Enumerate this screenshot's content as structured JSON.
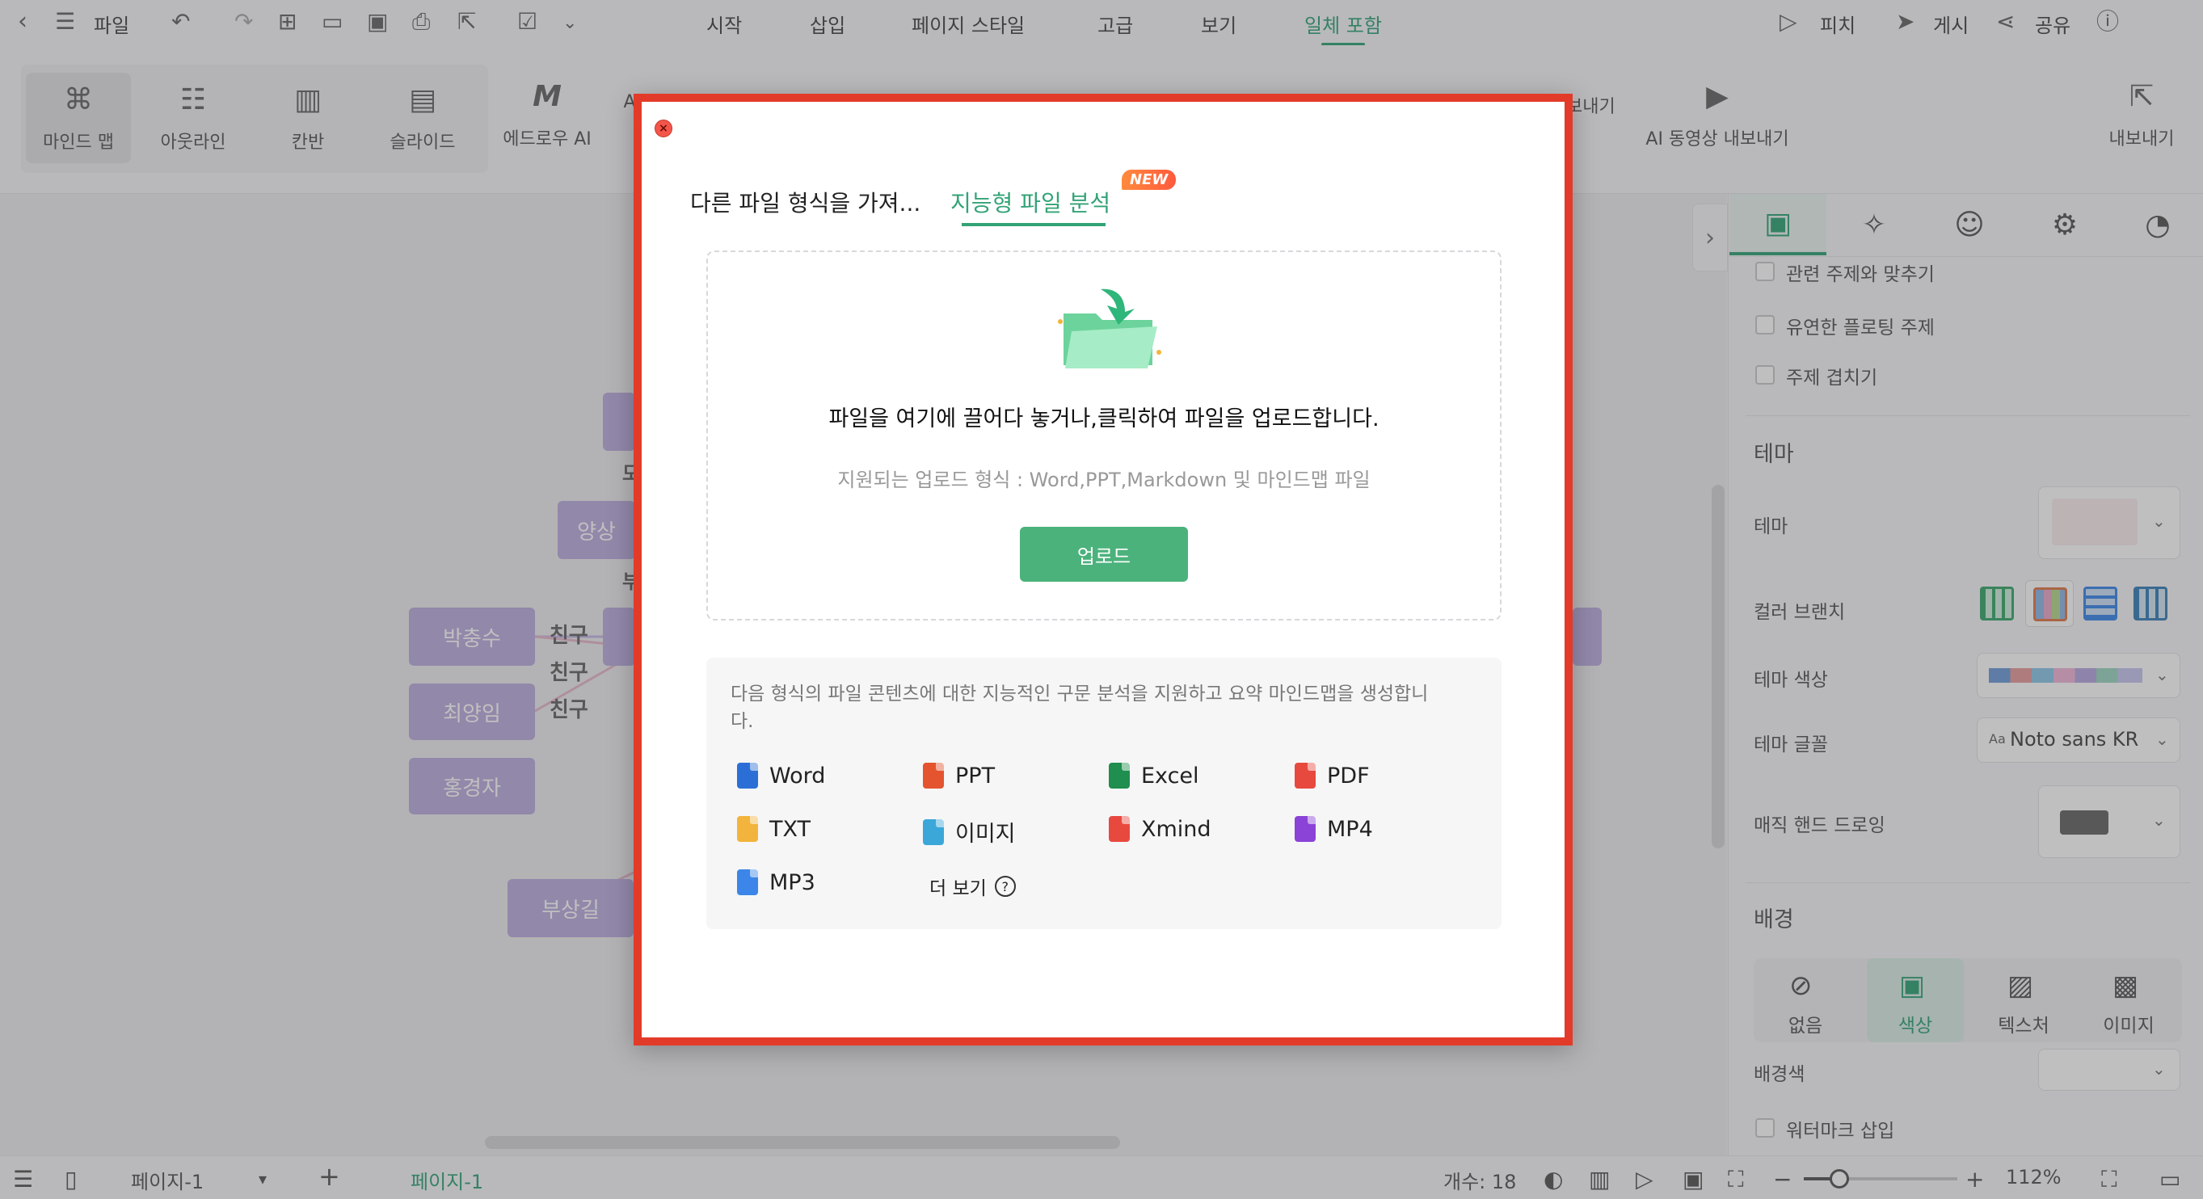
{
  "menubar": {
    "file": "파일",
    "menus": [
      "시작",
      "삽입",
      "페이지 스타일",
      "고급",
      "보기",
      "일체 포함"
    ],
    "right": {
      "pitch": "피치",
      "publish": "게시",
      "share": "공유"
    }
  },
  "toolbar": {
    "views": [
      "마인드 맵",
      "아웃라인",
      "칸반",
      "슬라이드"
    ],
    "edraw_ai": "에드로우 AI",
    "partial_ai": "A",
    "partial_export": "보내기",
    "ai_video_export": "AI 동영상 내보내기",
    "export": "내보내기"
  },
  "canvas": {
    "nodes": [
      "양상",
      "박충수",
      "최양임",
      "홍경자",
      "부상길"
    ],
    "relations": [
      "친구",
      "친구",
      "친구"
    ],
    "fragments": [
      "모",
      "부"
    ]
  },
  "right_panel": {
    "checkboxes": [
      "관련 주제와 맞추기",
      "유연한 플로팅 주제",
      "주제 겹치기"
    ],
    "theme_section": "테마",
    "theme_label": "테마",
    "color_branch_label": "컬러 브랜치",
    "theme_color_label": "테마 색상",
    "theme_font_label": "테마 글꼴",
    "theme_font_value": "Noto sans KR",
    "theme_font_prefix": "Aa",
    "magic_hand_label": "매직 핸드 드로잉",
    "background_section": "배경",
    "bg_options": [
      "없음",
      "색상",
      "텍스처",
      "이미지"
    ],
    "bg_color_label": "배경색",
    "watermark_label": "워터마크 삽입"
  },
  "bottombar": {
    "page_select": "페이지-1",
    "page_tab": "페이지-1",
    "count": "개수: 18",
    "zoom": "112%"
  },
  "dialog": {
    "tab_import": "다른 파일 형식을 가져...",
    "tab_smart": "지능형 파일 분석",
    "new_badge": "NEW",
    "drop_text": "파일을 여기에 끌어다 놓거나,클릭하여 파일을 업로드합니다.",
    "supported": "지원되는 업로드 형식 : Word,PPT,Markdown 및 마인드맵 파일",
    "upload_button": "업로드",
    "info_text": "다음 형식의 파일 콘텐츠에 대한 지능적인 구문 분석을 지원하고 요약 마인드맵을 생성합니다.",
    "formats": [
      {
        "label": "Word",
        "color": "#2b6fd6"
      },
      {
        "label": "PPT",
        "color": "#e3542f"
      },
      {
        "label": "Excel",
        "color": "#1f8e4e"
      },
      {
        "label": "PDF",
        "color": "#e8493f"
      },
      {
        "label": "TXT",
        "color": "#f2b43c"
      },
      {
        "label": "이미지",
        "color": "#3aa7d8"
      },
      {
        "label": "Xmind",
        "color": "#e8493f"
      },
      {
        "label": "MP4",
        "color": "#8a43d6"
      },
      {
        "label": "MP3",
        "color": "#3b86e8"
      }
    ],
    "more": "더 보기",
    "help_glyph": "?"
  },
  "colors": {
    "accent": "#32a376",
    "highlight": "#e33b2a",
    "node": "#bdaede"
  }
}
